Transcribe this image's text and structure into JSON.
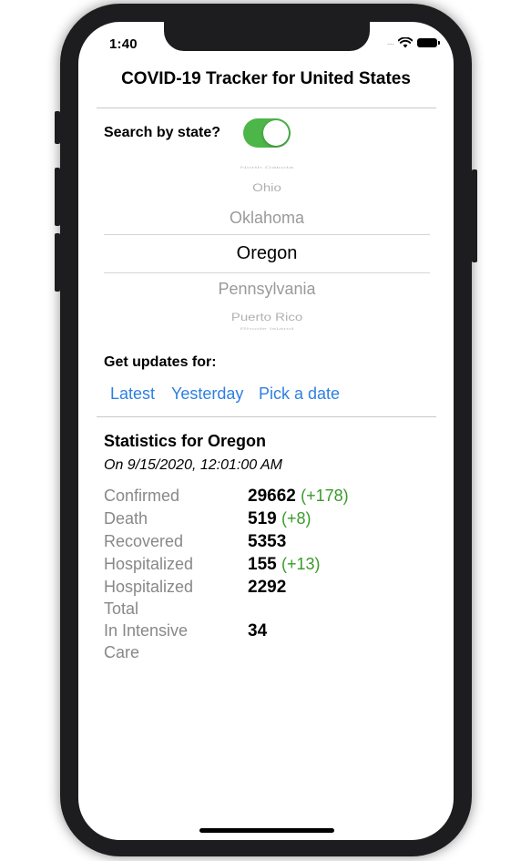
{
  "status_bar": {
    "time": "1:40",
    "signal": "....",
    "wifi_icon": "wifi-icon",
    "battery_icon": "battery-icon"
  },
  "header": {
    "title": "COVID-19 Tracker for United States"
  },
  "search": {
    "label": "Search by state?",
    "toggle_on": true,
    "toggle_color": "#4cb648"
  },
  "picker": {
    "items": [
      "North Dakota",
      "Ohio",
      "Oklahoma",
      "Oregon",
      "Pennsylvania",
      "Puerto Rico",
      "Rhode Island"
    ],
    "selected": "Oregon"
  },
  "updates": {
    "label": "Get updates for:",
    "options": [
      "Latest",
      "Yesterday",
      "Pick a date"
    ],
    "link_color": "#2f7fe0"
  },
  "stats": {
    "title": "Statistics for Oregon",
    "date": "On 9/15/2020, 12:01:00 AM",
    "rows": [
      {
        "label": "Confirmed",
        "value": "29662",
        "delta": "(+178)"
      },
      {
        "label": "Death",
        "value": "519",
        "delta": "(+8)"
      },
      {
        "label": "Recovered",
        "value": "5353",
        "delta": ""
      },
      {
        "label": "Hospitalized",
        "value": "155",
        "delta": "(+13)"
      },
      {
        "label": "Hospitalized Total",
        "value": "2292",
        "delta": ""
      },
      {
        "label": "In Intensive Care",
        "value": "34",
        "delta": ""
      }
    ],
    "delta_color": "#3a9a2a"
  }
}
